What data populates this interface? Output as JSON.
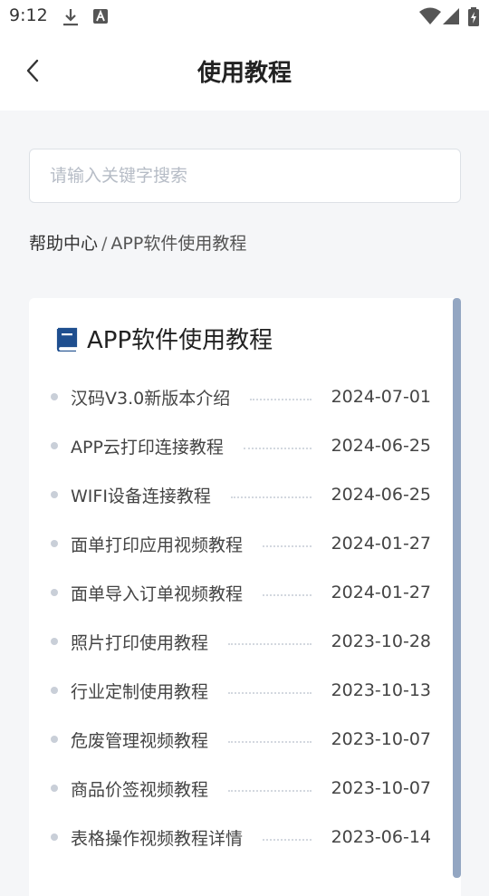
{
  "status_bar": {
    "time": "9:12",
    "icons": [
      "download-icon",
      "app-a-icon",
      "wifi-icon",
      "signal-icon",
      "battery-icon"
    ]
  },
  "header": {
    "title": "使用教程",
    "back_icon": "chevron-left-icon"
  },
  "search": {
    "placeholder": "请输入关键字搜索",
    "value": ""
  },
  "breadcrumb": {
    "root": "帮助中心",
    "separator": "/",
    "current": "APP软件使用教程"
  },
  "section": {
    "icon": "book-icon",
    "title": "APP软件使用教程",
    "items": [
      {
        "title": "汉码V3.0新版本介绍",
        "date": "2024-07-01"
      },
      {
        "title": "APP云打印连接教程",
        "date": "2024-06-25"
      },
      {
        "title": "WIFI设备连接教程",
        "date": "2024-06-25"
      },
      {
        "title": "面单打印应用视频教程",
        "date": "2024-01-27"
      },
      {
        "title": "面单导入订单视频教程",
        "date": "2024-01-27"
      },
      {
        "title": "照片打印使用教程",
        "date": "2023-10-28"
      },
      {
        "title": "行业定制使用教程",
        "date": "2023-10-13"
      },
      {
        "title": "危废管理视频教程",
        "date": "2023-10-07"
      },
      {
        "title": "商品价签视频教程",
        "date": "2023-10-07"
      },
      {
        "title": "表格操作视频教程详情",
        "date": "2023-06-14"
      }
    ]
  },
  "colors": {
    "accent": "#1f4f8f",
    "scrollbar": "#93a6c2",
    "background": "#f5f6f8"
  }
}
